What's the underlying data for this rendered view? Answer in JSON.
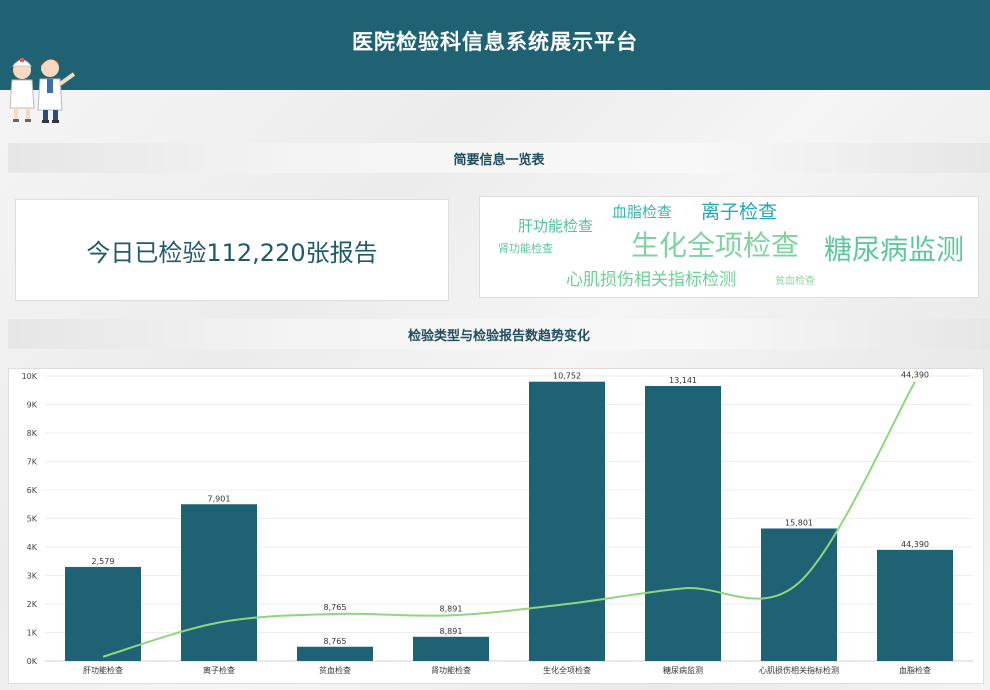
{
  "header": {
    "title": "医院检验科信息系统展示平台"
  },
  "summary": {
    "section_title": "简要信息一览表",
    "today_text": "今日已检验112,220张报告"
  },
  "word_cloud": [
    {
      "text": "肝功能检查",
      "size": 15,
      "color": "#4fc3a1"
    },
    {
      "text": "血脂检查",
      "size": 15,
      "color": "#3cb5b0"
    },
    {
      "text": "离子检查",
      "size": 19,
      "color": "#22a9b5"
    },
    {
      "text": "肾功能检查",
      "size": 11,
      "color": "#5fc8a0"
    },
    {
      "text": "生化全项检查",
      "size": 28,
      "color": "#7ed3a0"
    },
    {
      "text": "糖尿病监测",
      "size": 28,
      "color": "#5ec79b"
    },
    {
      "text": "心肌损伤相关指标检测",
      "size": 17,
      "color": "#6fcf97"
    },
    {
      "text": "贫血检查",
      "size": 10,
      "color": "#8ad5a2"
    }
  ],
  "trend": {
    "section_title": "检验类型与检验报告数趋势变化"
  },
  "chart_data": {
    "type": "bar",
    "categories": [
      "肝功能检查",
      "离子检查",
      "贫血检查",
      "肾功能检查",
      "生化全项检查",
      "糖尿病监测",
      "心肌损伤相关指标检测",
      "血脂检查"
    ],
    "bar_values": [
      3300,
      5500,
      500,
      850,
      9800,
      9650,
      4650,
      3900
    ],
    "line_values": [
      150,
      1350,
      1650,
      1600,
      2000,
      2550,
      2750,
      9800
    ],
    "bar_labels": [
      "2,579",
      "7,901",
      "8,765",
      "8,891",
      "10,752",
      "13,141",
      "15,801",
      "44,390"
    ],
    "line_labels": [
      "",
      "",
      "8,765",
      "8,891",
      "",
      "",
      "",
      "44,390"
    ],
    "y_ticks": [
      "0K",
      "1K",
      "2K",
      "3K",
      "4K",
      "5K",
      "6K",
      "7K",
      "8K",
      "9K",
      "10K"
    ],
    "ylim": [
      0,
      10000
    ],
    "bar_color": "#1f6274",
    "line_color": "#8fd67e"
  }
}
